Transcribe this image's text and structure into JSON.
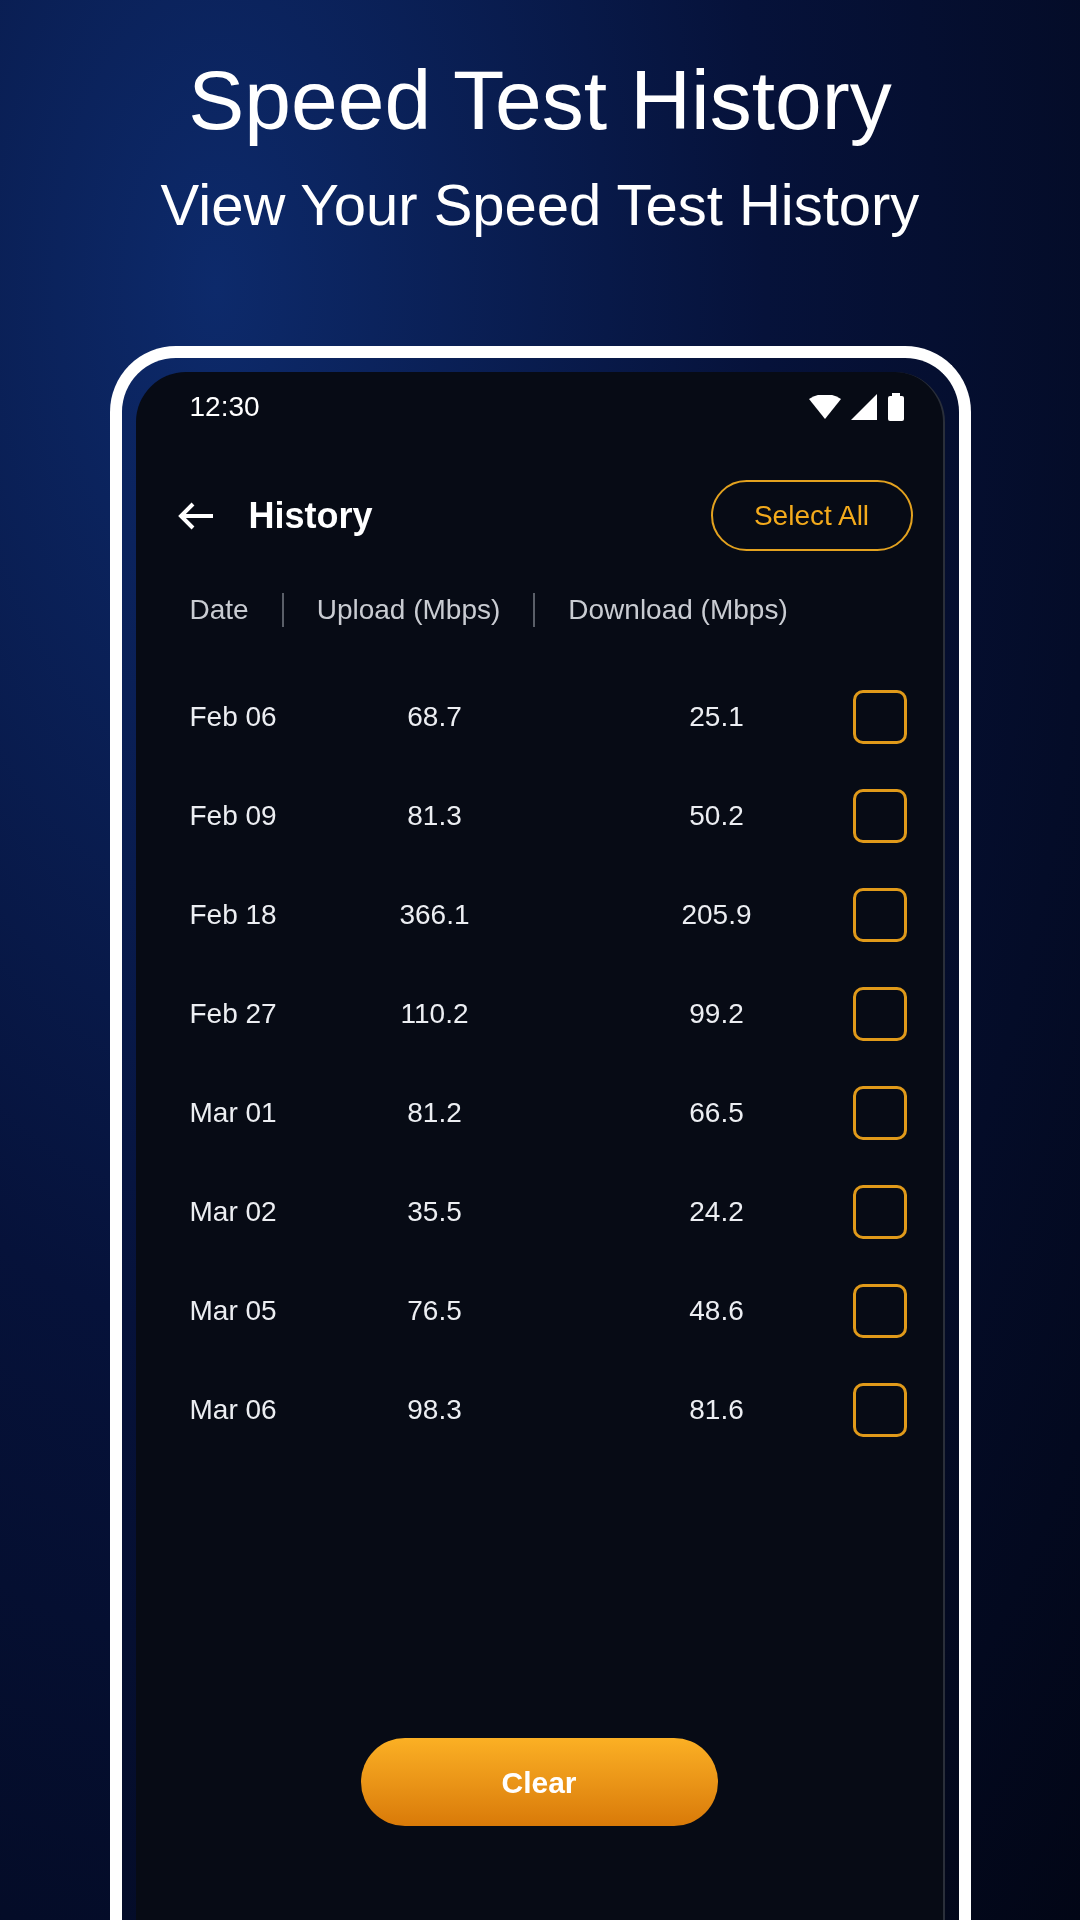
{
  "headline": {
    "title": "Speed Test History",
    "subtitle": "View Your Speed Test History"
  },
  "status_bar": {
    "time": "12:30"
  },
  "app_bar": {
    "title": "History",
    "action": "Select All"
  },
  "table": {
    "columns": [
      "Date",
      "Upload (Mbps)",
      "Download (Mbps)"
    ],
    "rows": [
      {
        "date": "Feb 06",
        "upload": "68.7",
        "download": "25.1",
        "checked": false
      },
      {
        "date": "Feb 09",
        "upload": "81.3",
        "download": "50.2",
        "checked": false
      },
      {
        "date": "Feb 18",
        "upload": "366.1",
        "download": "205.9",
        "checked": false
      },
      {
        "date": "Feb 27",
        "upload": "110.2",
        "download": "99.2",
        "checked": false
      },
      {
        "date": "Mar 01",
        "upload": "81.2",
        "download": "66.5",
        "checked": false
      },
      {
        "date": "Mar 02",
        "upload": "35.5",
        "download": "24.2",
        "checked": false
      },
      {
        "date": "Mar 05",
        "upload": "76.5",
        "download": "48.6",
        "checked": false
      },
      {
        "date": "Mar 06",
        "upload": "98.3",
        "download": "81.6",
        "checked": false
      }
    ]
  },
  "clear_button": "Clear"
}
